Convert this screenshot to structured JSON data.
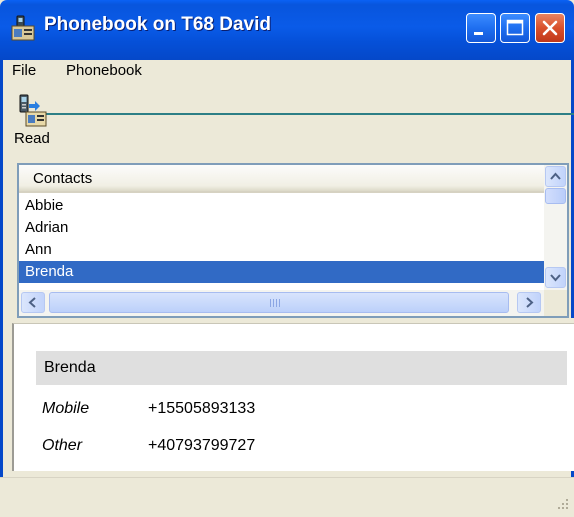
{
  "window": {
    "title": "Phonebook on T68 David",
    "icon": "phonebook-app-icon",
    "colors": {
      "titlebar": "#0a5be8",
      "close": "#d9502c",
      "selection": "#316ac5"
    }
  },
  "menu": {
    "items": [
      {
        "label": "File"
      },
      {
        "label": "Phonebook"
      }
    ]
  },
  "toolbar": {
    "read_label": "Read",
    "read_icon": "phone-read-icon"
  },
  "contacts": {
    "header": "Contacts",
    "rows": [
      {
        "name": "Abbie",
        "selected": false
      },
      {
        "name": "Adrian",
        "selected": false
      },
      {
        "name": "Ann",
        "selected": false
      },
      {
        "name": "Brenda",
        "selected": true
      }
    ]
  },
  "details": {
    "name": "Brenda",
    "phones": [
      {
        "type": "Mobile",
        "number": "+15505893133"
      },
      {
        "type": "Other",
        "number": "+40793799727"
      }
    ]
  }
}
